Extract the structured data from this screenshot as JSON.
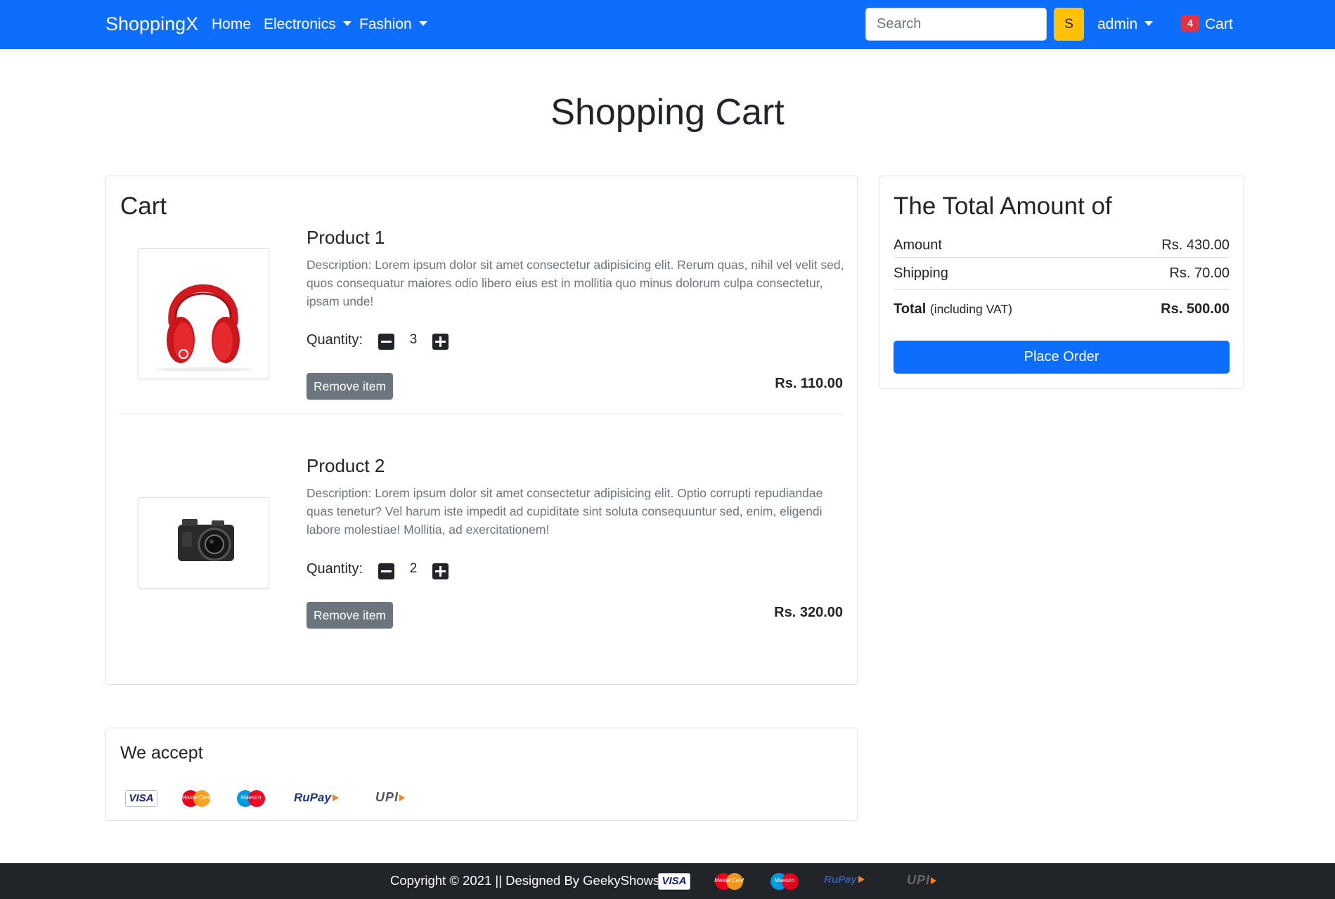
{
  "navbar": {
    "brand": "ShoppingX",
    "links": [
      {
        "label": "Home"
      },
      {
        "label": "Electronics"
      },
      {
        "label": "Fashion"
      }
    ],
    "search_placeholder": "Search",
    "search_button": "S",
    "user": "admin",
    "cart_count": "4",
    "cart_label": "Cart",
    "color": "#0d6efd"
  },
  "page": {
    "title": "Shopping Cart"
  },
  "cart": {
    "heading": "Cart",
    "items": [
      {
        "name": "Product 1",
        "description": "Description: Lorem ipsum dolor sit amet consectetur adipisicing elit. Rerum quas, nihil vel velit sed, quos consequatur maiores odio libero eius est in mollitia quo minus dolorum culpa consectetur, ipsam unde!",
        "quantity_label": "Quantity:",
        "quantity": "3",
        "remove_label": "Remove item",
        "price": "Rs. 110.00",
        "image_icon": "headphones-image"
      },
      {
        "name": "Product 2",
        "description": "Description: Lorem ipsum dolor sit amet consectetur adipisicing elit. Optio corrupti repudiandae quas tenetur? Vel harum iste impedit ad cupiditate sint soluta consequuntur sed, enim, eligendi labore molestiae! Mollitia, ad exercitationem!",
        "quantity_label": "Quantity:",
        "quantity": "2",
        "remove_label": "Remove item",
        "price": "Rs. 320.00",
        "image_icon": "camera-image"
      }
    ]
  },
  "summary": {
    "heading": "The Total Amount of",
    "amount_label": "Amount",
    "amount_value": "Rs. 430.00",
    "shipping_label": "Shipping",
    "shipping_value": "Rs. 70.00",
    "total_label": "Total",
    "total_note": "(including VAT)",
    "total_value": "Rs. 500.00",
    "place_order": "Place Order"
  },
  "payments": {
    "heading": "We accept",
    "logos": [
      "VISA",
      "MasterCard",
      "Maestro",
      "RuPay",
      "UPI"
    ]
  },
  "footer": {
    "text": "Copyright © 2021 || Designed By GeekyShows ||"
  }
}
